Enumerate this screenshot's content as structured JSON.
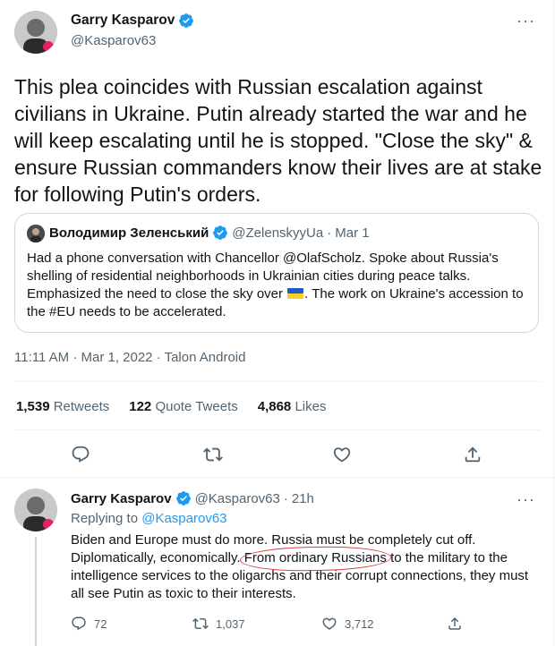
{
  "main_tweet": {
    "author_name": "Garry Kasparov",
    "author_handle": "@Kasparov63",
    "more_glyph": "···",
    "text": "This plea coincides with Russian escalation against civilians in Ukraine. Putin already started the war and he will keep escalating until he is stopped. \"Close the sky\" & ensure Russian commanders know their lives are at stake for following Putin's orders.",
    "timestamp": "11:11 AM · Mar 1, 2022 · Talon Android",
    "stats": {
      "retweets_count": "1,539",
      "retweets_label": "Retweets",
      "quotes_count": "122",
      "quotes_label": "Quote Tweets",
      "likes_count": "4,868",
      "likes_label": "Likes"
    }
  },
  "quoted_tweet": {
    "author_name": "Володимир Зеленський",
    "author_handle": "@ZelenskyyUa",
    "separator": "·",
    "date": "Mar 1",
    "text_before_flag": "Had a phone conversation with Chancellor @OlafScholz. Spoke about Russia's shelling of residential neighborhoods in Ukrainian cities during peace talks. Emphasized the need to close the sky over ",
    "flag_icon": "ukraine-flag-emoji",
    "text_after_flag": ". The work on Ukraine's accession to the #EU needs to be accelerated."
  },
  "reply": {
    "author_name": "Garry Kasparov",
    "author_handle": "@Kasparov63",
    "separator": "·",
    "age": "21h",
    "more_glyph": "···",
    "replying_label": "Replying to",
    "replying_handle": "@Kasparov63",
    "text_before": "Biden and Europe must do more. Russia must be completely cut off. Diplomatically, economically. ",
    "text_circled": "From ordinary Russians",
    "text_after": " to the military to the intelligence services to the oligarchs and their corrupt connections, they must all see Putin as toxic to their interests.",
    "reply_count": "72",
    "retweet_count": "1,037",
    "like_count": "3,712"
  },
  "colors": {
    "accent": "#1d9bf0",
    "secondary_text": "#536471",
    "primary_text": "#0f1419",
    "border": "#cfd9de",
    "annotation": "#d93c3c"
  },
  "icons": [
    "verified-badge-icon",
    "more-icon",
    "reply-icon",
    "retweet-icon",
    "like-icon",
    "share-icon"
  ]
}
